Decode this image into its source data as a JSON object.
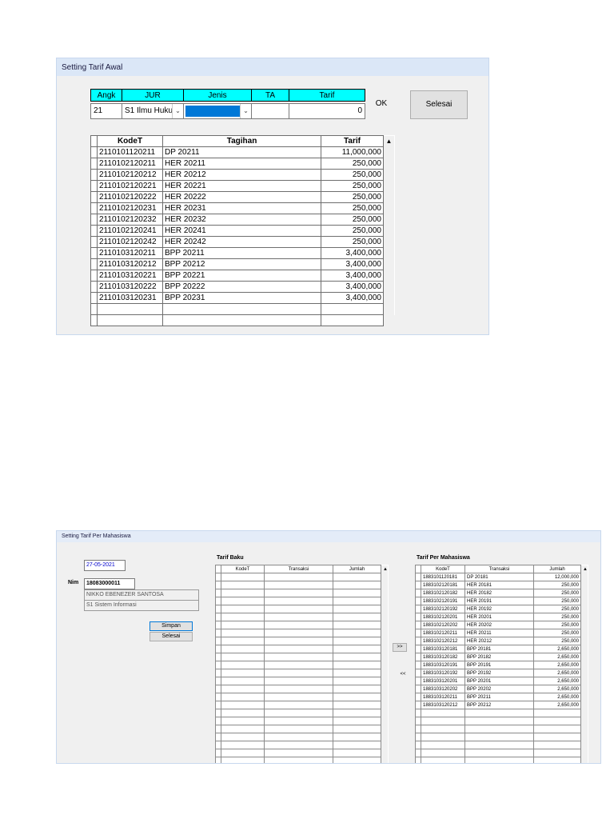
{
  "window1": {
    "title": "Setting Tarif Awal",
    "headers": {
      "angk": "Angk",
      "jur": "JUR",
      "jenis": "Jenis",
      "ta": "TA",
      "tarif": "Tarif"
    },
    "values": {
      "angk": "21",
      "jur": "S1 Ilmu Huku",
      "jenis": "",
      "ta": "",
      "tarif": "0"
    },
    "ok_label": "OK",
    "selesai_label": "Selesai",
    "grid": {
      "columns": [
        "KodeT",
        "Tagihan",
        "Tarif"
      ],
      "rows": [
        [
          "2110101120211",
          "DP 20211",
          "11,000,000"
        ],
        [
          "2110102120211",
          "HER 20211",
          "250,000"
        ],
        [
          "2110102120212",
          "HER 20212",
          "250,000"
        ],
        [
          "2110102120221",
          "HER 20221",
          "250,000"
        ],
        [
          "2110102120222",
          "HER 20222",
          "250,000"
        ],
        [
          "2110102120231",
          "HER 20231",
          "250,000"
        ],
        [
          "2110102120232",
          "HER 20232",
          "250,000"
        ],
        [
          "2110102120241",
          "HER 20241",
          "250,000"
        ],
        [
          "2110102120242",
          "HER 20242",
          "250,000"
        ],
        [
          "2110103120211",
          "BPP 20211",
          "3,400,000"
        ],
        [
          "2110103120212",
          "BPP 20212",
          "3,400,000"
        ],
        [
          "2110103120221",
          "BPP 20221",
          "3,400,000"
        ],
        [
          "2110103120222",
          "BPP 20222",
          "3,400,000"
        ],
        [
          "2110103120231",
          "BPP 20231",
          "3,400,000"
        ]
      ]
    }
  },
  "window2": {
    "title": "Setting Tarif Per Mahasiswa",
    "date": "27-05-2021",
    "nim_label": "Nim",
    "nim_value": "18083000011",
    "name": "NIKKO EBENEZER SANTOSA",
    "major": "S1 Sistem Informasi",
    "simpan_label": "Simpan",
    "selesai_label": "Selesai",
    "add_label": ">>",
    "remove_label": "<<",
    "tarif_baku": {
      "title": "Tarif Baku",
      "columns": [
        "KodeT",
        "Transaksi",
        "Jumlah"
      ]
    },
    "tarif_mhs": {
      "title": "Tarif Per Mahasiswa",
      "columns": [
        "KodeT",
        "Transaksi",
        "Jumlah"
      ],
      "rows": [
        [
          "1883101120181",
          "DP 20181",
          "12,000,000"
        ],
        [
          "1883102120181",
          "HER 20181",
          "250,000"
        ],
        [
          "1883102120182",
          "HER 20182",
          "250,000"
        ],
        [
          "1883102120191",
          "HER 20191",
          "250,000"
        ],
        [
          "1883102120192",
          "HER 20192",
          "250,000"
        ],
        [
          "1883102120201",
          "HER 20201",
          "250,000"
        ],
        [
          "1883102120202",
          "HER 20202",
          "250,000"
        ],
        [
          "1883102120211",
          "HER 20211",
          "250,000"
        ],
        [
          "1883102120212",
          "HER 20212",
          "250,000"
        ],
        [
          "1883103120181",
          "BPP 20181",
          "2,650,000"
        ],
        [
          "1883103120182",
          "BPP 20182",
          "2,650,000"
        ],
        [
          "1883103120191",
          "BPP 20191",
          "2,650,000"
        ],
        [
          "1883103120192",
          "BPP 20192",
          "2,650,000"
        ],
        [
          "1883103120201",
          "BPP 20201",
          "2,650,000"
        ],
        [
          "1883103120202",
          "BPP 20202",
          "2,650,000"
        ],
        [
          "1883103120211",
          "BPP 20211",
          "2,650,000"
        ],
        [
          "1883103120212",
          "BPP 20212",
          "2,650,000"
        ]
      ]
    }
  }
}
